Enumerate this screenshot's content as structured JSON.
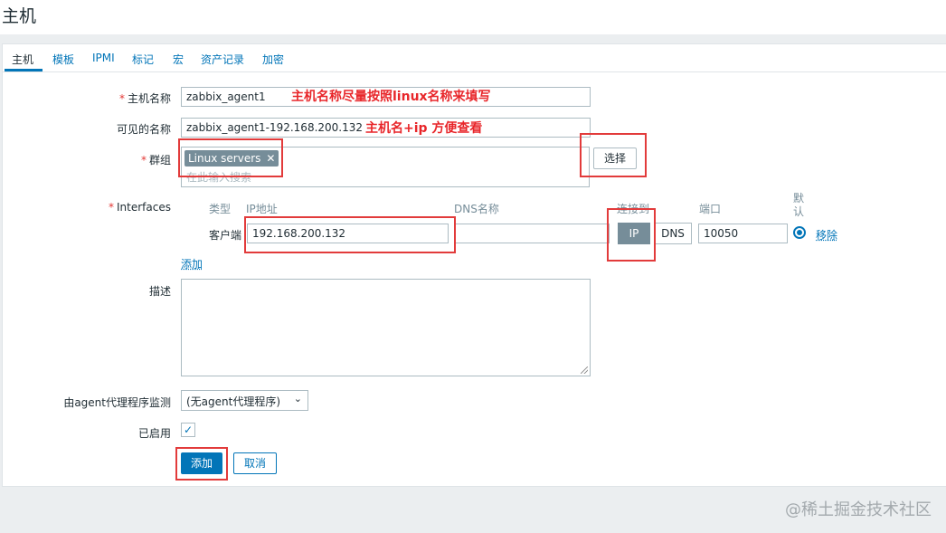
{
  "page_title": "主机",
  "tabs": [
    {
      "label": "主机"
    },
    {
      "label": "模板"
    },
    {
      "label": "IPMI"
    },
    {
      "label": "标记"
    },
    {
      "label": "宏"
    },
    {
      "label": "资产记录"
    },
    {
      "label": "加密"
    }
  ],
  "form": {
    "hostname_label": "主机名称",
    "hostname_value": "zabbix_agent1",
    "visible_name_label": "可见的名称",
    "visible_name_value": "zabbix_agent1-192.168.200.132",
    "groups_label": "群组",
    "group_chip": "Linux servers",
    "group_chip_remove": "✕",
    "groups_placeholder": "在此输入搜索",
    "select_button": "选择",
    "interfaces_label": "Interfaces",
    "interfaces": {
      "col_type": "类型",
      "col_ip": "IP地址",
      "col_dns": "DNS名称",
      "col_connect": "连接到",
      "col_port": "端口",
      "col_default": "默认",
      "row_type": "客户端",
      "ip_value": "192.168.200.132",
      "dns_value": "",
      "connect_ip": "IP",
      "connect_dns": "DNS",
      "port_value": "10050",
      "remove_link": "移除"
    },
    "add_interface_link": "添加",
    "description_label": "描述",
    "proxy_label": "由agent代理程序监测",
    "proxy_value": "(无agent代理程序)",
    "enabled_label": "已启用",
    "enabled_checked": true,
    "add_button": "添加",
    "cancel_button": "取消"
  },
  "annotations": {
    "hostname_note": "主机名称尽量按照linux名称来填写",
    "visible_name_note": "主机名+ip 方便查看"
  },
  "watermark": "@稀土掘金技术社区",
  "colors": {
    "accent": "#0275b8",
    "required": "#e33734",
    "annotation_red": "#e8262a",
    "chip_bg": "#768d99"
  }
}
